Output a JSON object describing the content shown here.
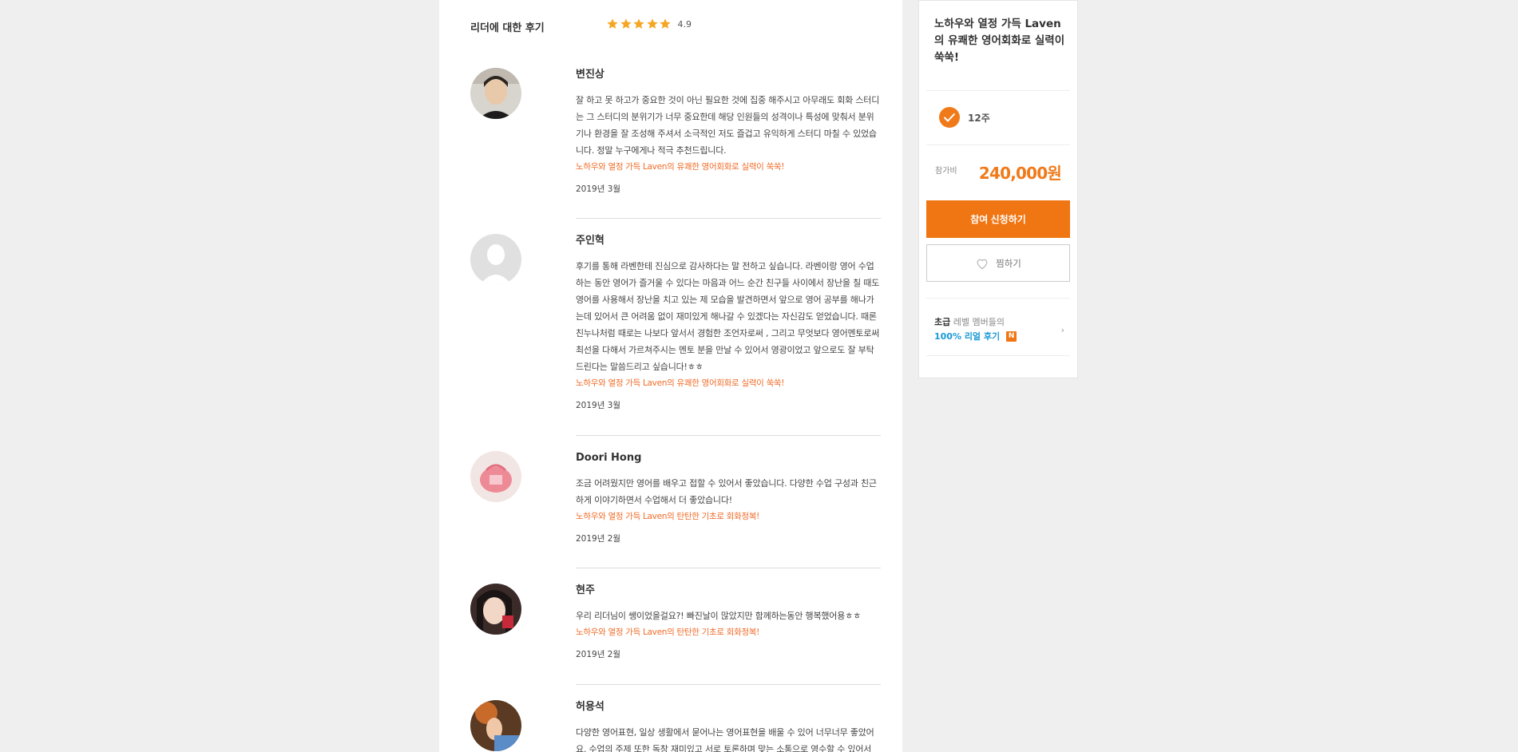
{
  "review_section": {
    "title": "리더에 대한 후기",
    "stars": 5,
    "score": "4.9"
  },
  "reviews": [
    {
      "name": "변진상",
      "text": "잘 하고 못 하고가 중요한 것이 아닌 필요한 것에 집중 해주시고 아무래도 회화 스터디는 그 스터디의 분위기가 너무 중요한데 해당 인원들의 성격이나 특성에 맞춰서 분위기나 환경을 잘 조성해 주셔서 소극적인 저도 즐겁고 유익하게 스터디 마칠 수 있었습니다. 정말 누구에게나 적극 추천드립니다.",
      "course": "노하우와 열정 가득 Laven의 유쾌한 영어회화로 실력이 쑥쑥!",
      "date": "2019년 3월",
      "avatar": "photo-man"
    },
    {
      "name": "주인혁",
      "text": "후기를 통해 라벤한테 진심으로 감사하다는 말 전하고 싶습니다. 라벤이랑 영어 수업하는 동안 영어가 즐거울 수 있다는 마음과 어느 순간 친구들 사이에서 장난을 칠 때도 영어를 사용해서 장난을 치고 있는 제 모습을 발견하면서 앞으로 영어 공부를 해나가는데 있어서 큰 어려움 없이 재미있게 해나갈 수 있겠다는 자신감도 얻었습니다. 때론 친누나처럼 때로는 나보다 앞서서 경험한 조언자로써 , 그리고 무엇보다 영어멘토로써 최선을 다해서 가르쳐주시는 멘토 분을 만날 수 있어서 영광이었고 앞으로도 잘 부탁드린다는 말씀드리고 싶습니다!ㅎㅎ",
      "course": "노하우와 열정 가득 Laven의 유쾌한 영어회화로 실력이 쑥쑥!",
      "date": "2019년 3월",
      "avatar": "default-avatar"
    },
    {
      "name": "Doori Hong",
      "text": "조금 어려웠지만 영어를 배우고 접할 수 있어서 좋았습니다. 다양한 수업 구성과 친근하게 이야기하면서 수업해서 더 좋았습니다!",
      "course": "노하우와 열정 가득 Laven의 탄탄한 기초로 회화정복!",
      "date": "2019년 2월",
      "avatar": "photo-pink"
    },
    {
      "name": "현주",
      "text": "우리 리더님이 쌩이었을걸요?! 빠진날이 많았지만 함께하는동안 행복했어용ㅎㅎ",
      "course": "노하우와 열정 가득 Laven의 탄탄한 기초로 회화정복!",
      "date": "2019년 2월",
      "avatar": "photo-woman"
    },
    {
      "name": "허용석",
      "text": "다양한 영어표현, 일상 생활에서 묻어나는 영어표현을 배울 수 있어 너무너무 좋았어요. 수업의 주제 또한 독창 재미있고 서로 토론하며 맞는 소통으로 영수할 수 있어서",
      "course": "",
      "date": "",
      "avatar": "photo-hand"
    }
  ],
  "sidebar": {
    "title": "노하우와 열정 가득 Laven의  유쾌한 영어회화로 실력이 쑥쑥!",
    "duration": "12주",
    "fee_label": "참가비",
    "fee": "240,000원",
    "apply_label": "참여 신청하기",
    "wish_label": "찜하기",
    "member_level": "초급",
    "member_text": " 레벨 멤버들의",
    "member_highlight": "100% 리얼 후기",
    "badge": "N",
    "chevron": "›"
  },
  "colors": {
    "accent": "#f07613",
    "star": "#f5a623",
    "link": "#1a9ad6"
  }
}
